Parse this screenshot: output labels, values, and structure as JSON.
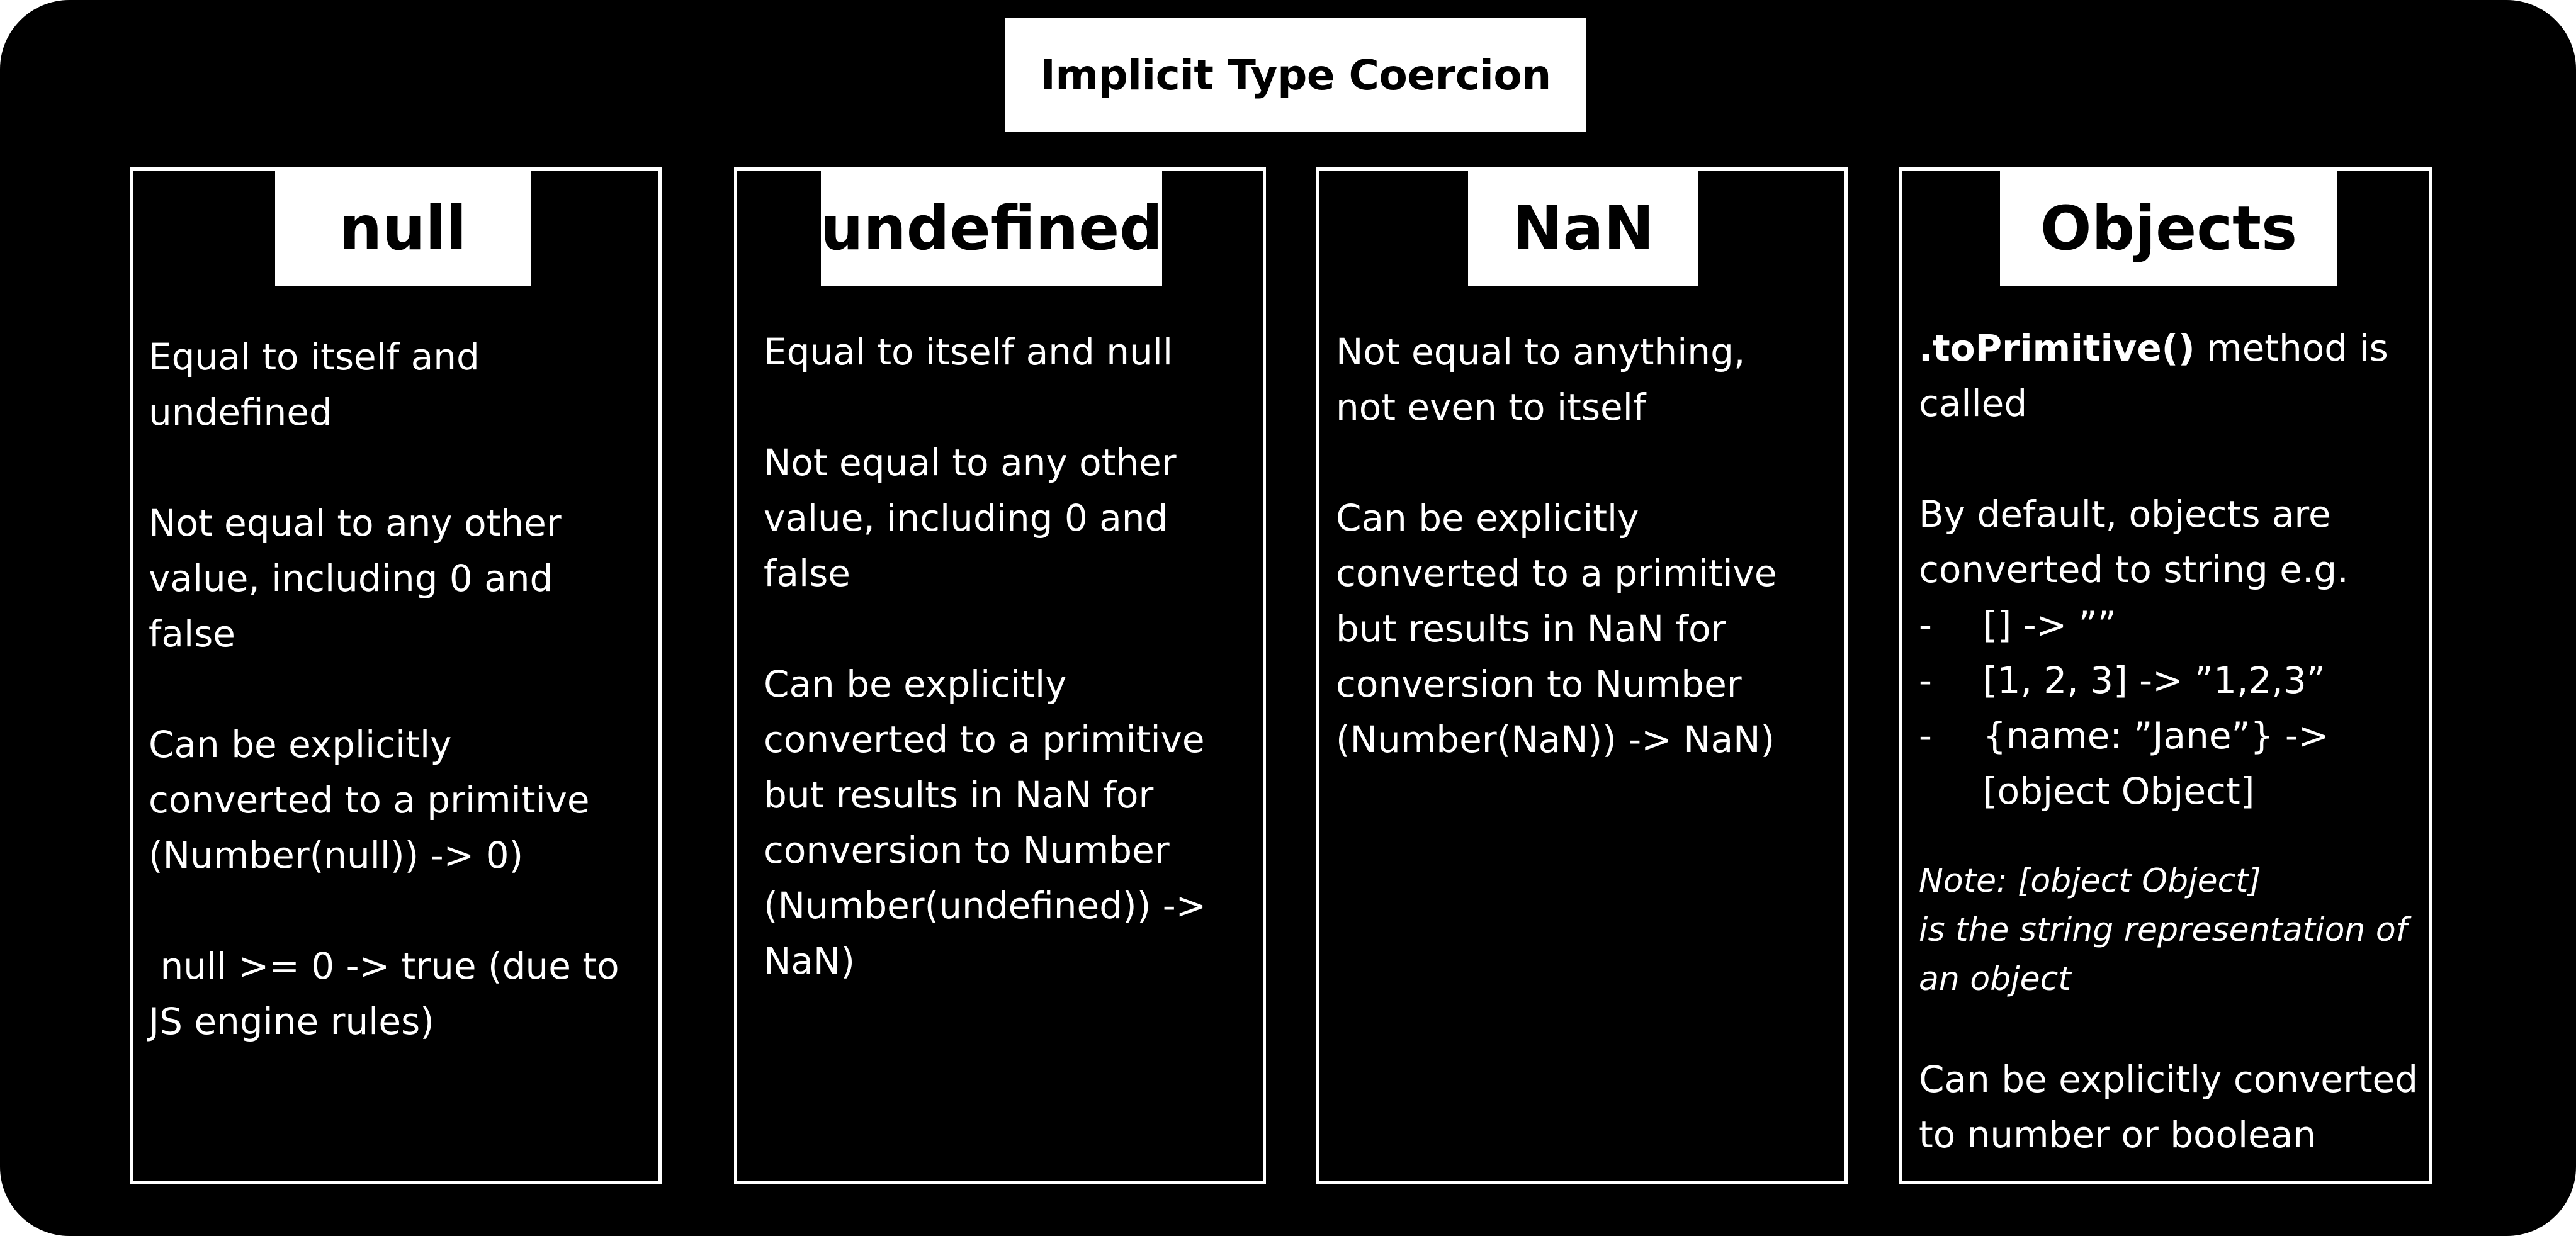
{
  "title": "Implicit Type Coercion",
  "columns": [
    {
      "header": "null",
      "paragraphs": [
        "Equal to itself and\nundefined",
        "Not equal to any other\nvalue, including 0 and\nfalse",
        "Can be explicitly\nconverted to a primitive\n(Number(null)) -> 0)",
        " null >= 0 -> true (due to\nJS engine rules)"
      ]
    },
    {
      "header": "undefined",
      "paragraphs": [
        "Equal to itself and null",
        "Not equal to any other\nvalue, including 0 and\nfalse",
        "Can be explicitly\nconverted to a primitive\nbut results in NaN for\nconversion to Number\n(Number(undefined)) ->\nNaN)"
      ]
    },
    {
      "header": "NaN",
      "paragraphs": [
        "Not equal to anything,\nnot even to itself",
        "Can be explicitly\nconverted to a primitive\nbut results in NaN for\nconversion to Number\n(Number(NaN)) -> NaN)"
      ]
    },
    {
      "header": "Objects",
      "intro_bold": ".toPrimitive()",
      "intro_rest": " method is\ncalled",
      "default_text": "By default, objects are\nconverted to string e.g.",
      "bullet_marker": "-",
      "bullets": [
        "[] -> ””",
        "[1, 2, 3] -> ”1,2,3”",
        "{name: ”Jane”} ->\n[object Object]"
      ],
      "note_lines": [
        "Note: [object Object]",
        "is the string representation of",
        "an object"
      ],
      "final_text": "Can be explicitly converted\nto number or boolean"
    }
  ]
}
